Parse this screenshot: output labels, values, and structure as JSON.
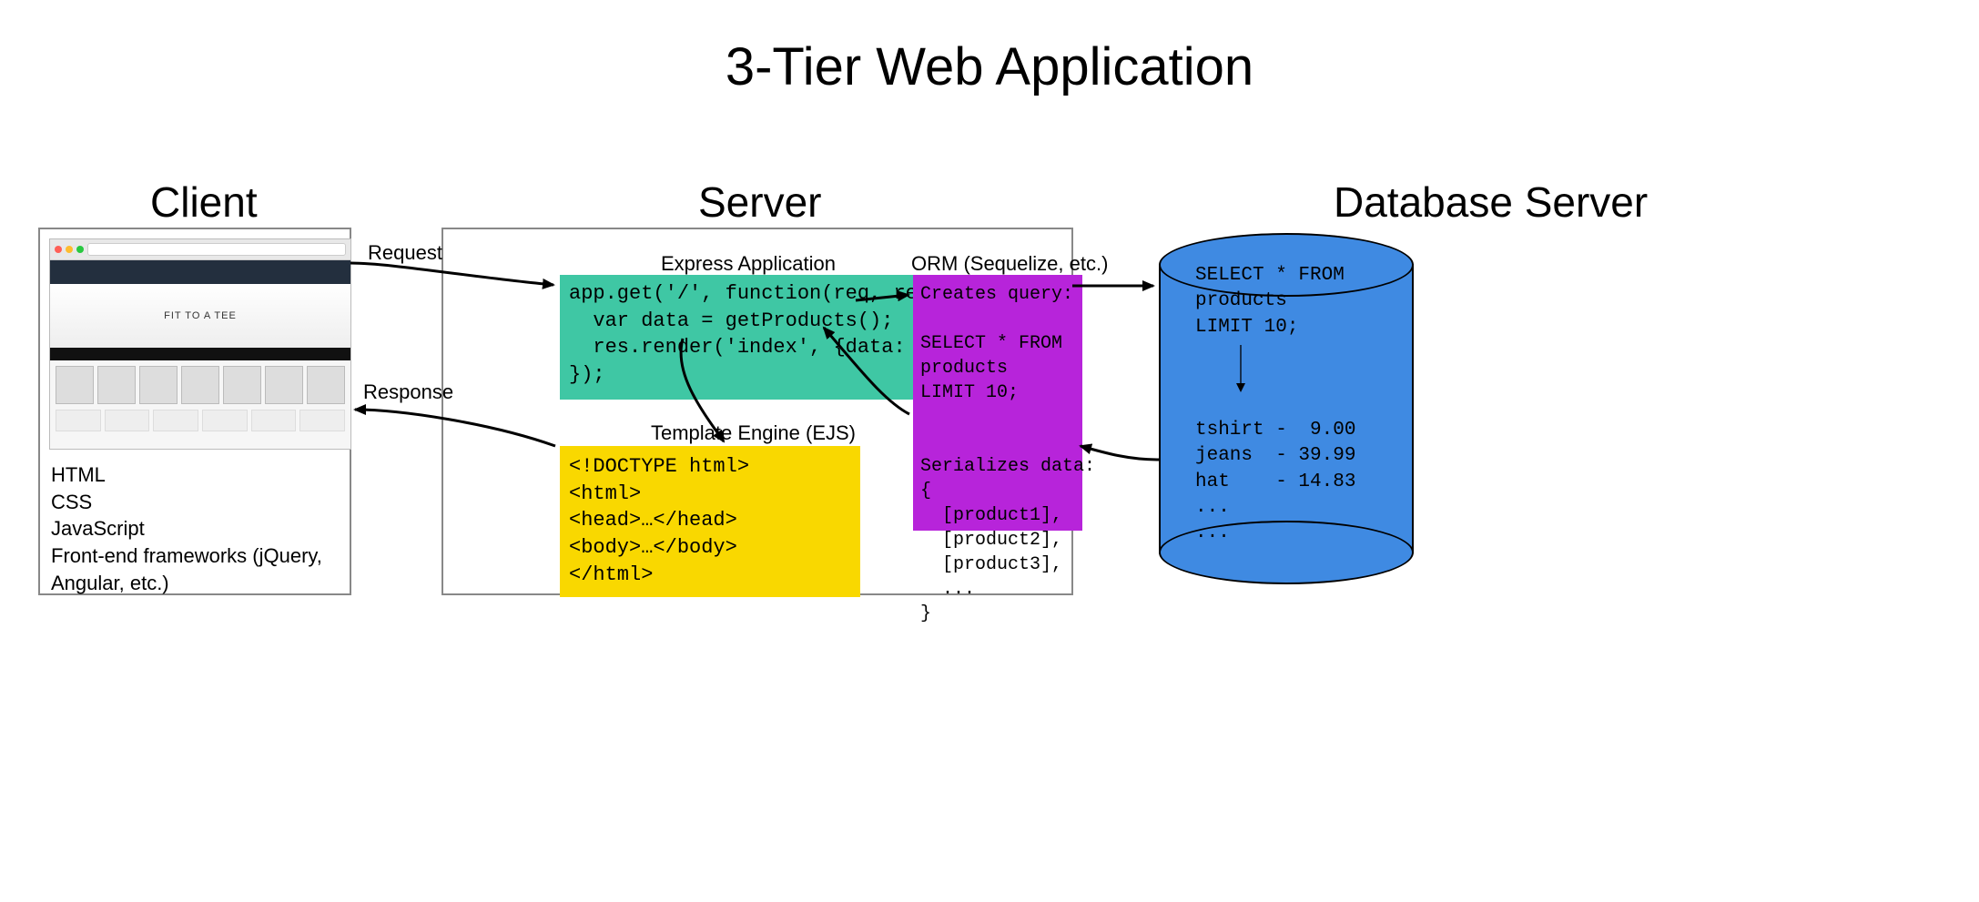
{
  "title": "3-Tier Web Application",
  "columns": {
    "client": "Client",
    "server": "Server",
    "db": "Database Server"
  },
  "arrows": {
    "request": "Request",
    "response": "Response"
  },
  "client": {
    "hero_text": "FIT TO A TEE",
    "caption_lines": [
      "HTML",
      "CSS",
      "JavaScript",
      "Front-end frameworks (jQuery, Angular, etc.)"
    ]
  },
  "server": {
    "express_label": "Express Application",
    "express_code": "app.get('/', function(req, res) {\n  var data = getProducts();\n  res.render('index', {data: data});\n});",
    "ejs_label": "Template Engine (EJS)",
    "ejs_code": "<!DOCTYPE html>\n<html>\n<head>…</head>\n<body>…</body>\n</html>",
    "orm_label": "ORM (Sequelize, etc.)",
    "orm_text": "Creates query:\n\nSELECT * FROM\nproducts\nLIMIT 10;\n\n\nSerializes data:\n{\n  [product1],\n  [product2],\n  [product3],\n  ...\n}"
  },
  "db": {
    "text": "SELECT * FROM\nproducts\nLIMIT 10;\n\n\n\ntshirt -  9.00\njeans  - 39.99\nhat    - 14.83\n...\n..."
  }
}
